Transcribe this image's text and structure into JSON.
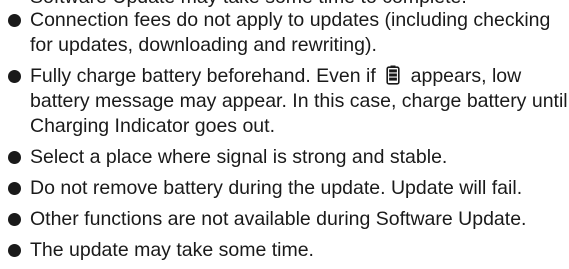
{
  "partial_top_line": "Software Update may take some time to complete.",
  "bullets": [
    {
      "text": "Connection fees do not apply to updates (including checking for updates, downloading and rewriting)."
    },
    {
      "before_icon": "Fully charge battery beforehand. Even if",
      "icon": "battery-icon",
      "after_icon": "appears, low battery message may appear. In this case, charge battery until Charging Indicator goes out."
    },
    {
      "text": "Select a place where signal is strong and stable."
    },
    {
      "text": "Do not remove battery during the update. Update will fail."
    },
    {
      "text": "Other functions are not available during Software Update."
    },
    {
      "text": "The update may take some time."
    }
  ],
  "colors": {
    "text": "#1a1a1a",
    "background": "#ffffff"
  }
}
